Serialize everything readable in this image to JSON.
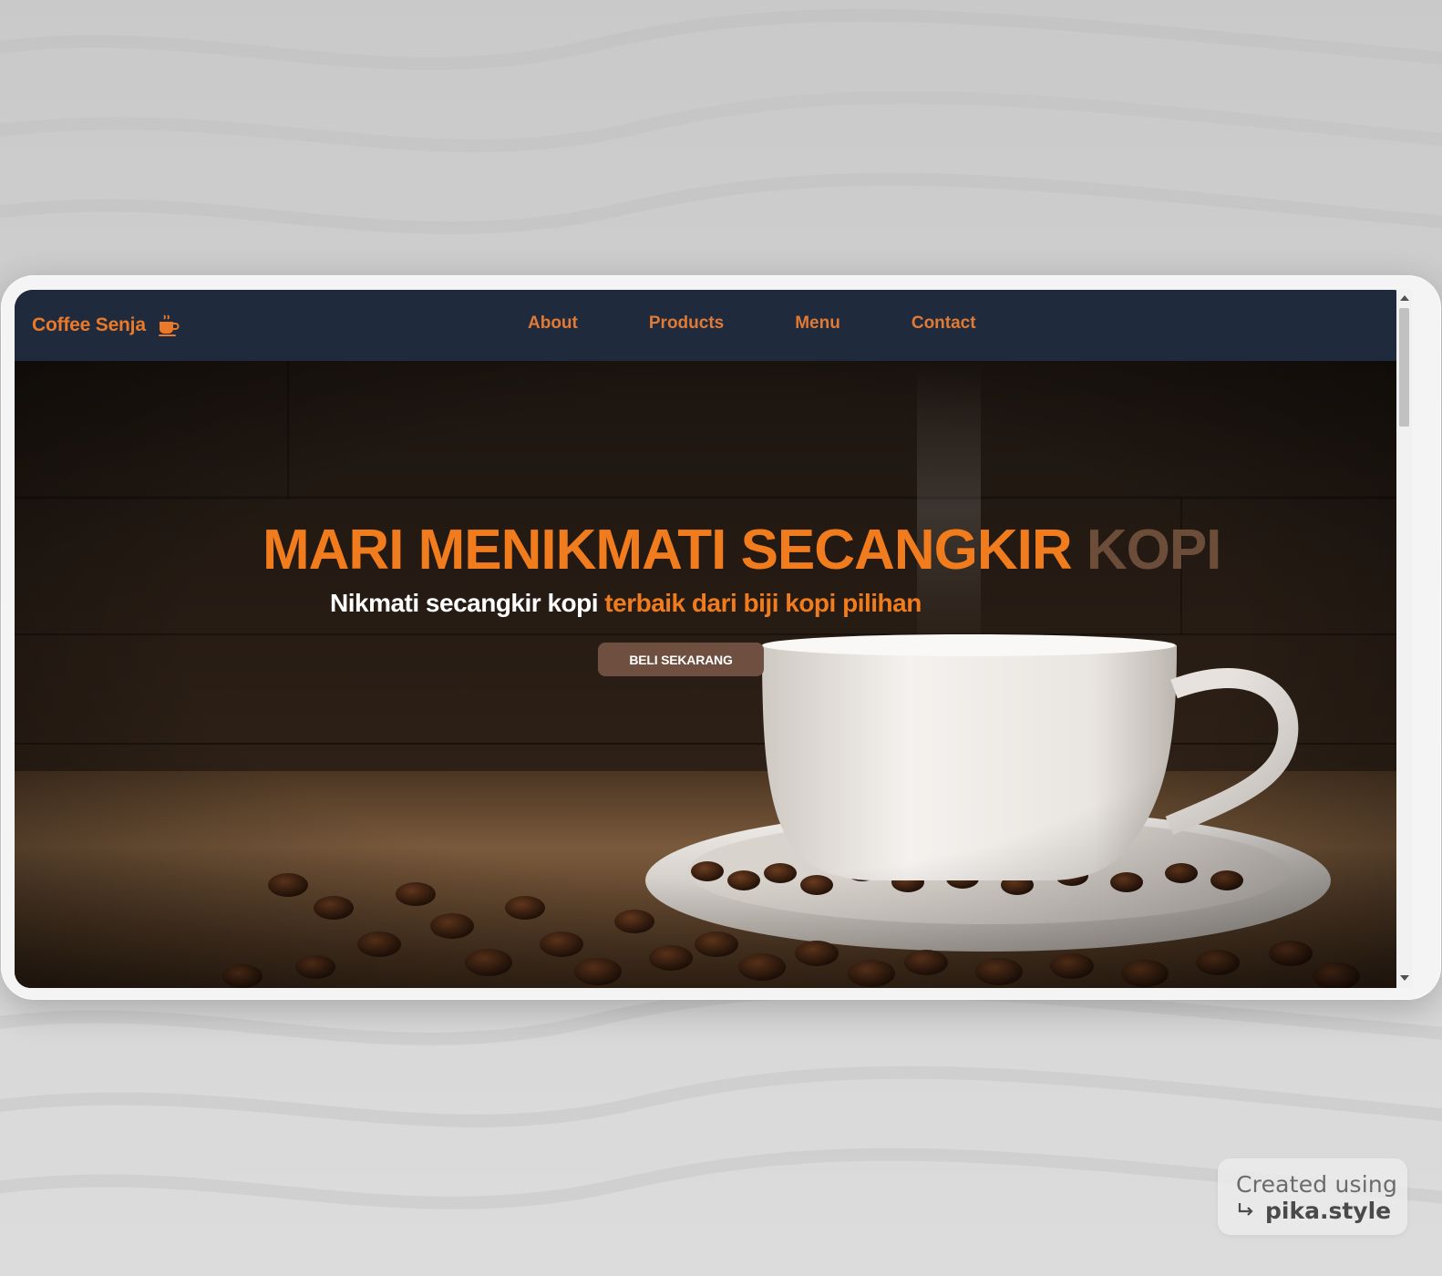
{
  "navbar": {
    "brand": "Coffee Senja",
    "brand_icon": "coffee-cup-icon",
    "links": [
      {
        "label": "About"
      },
      {
        "label": "Products"
      },
      {
        "label": "Menu"
      },
      {
        "label": "Contact"
      }
    ]
  },
  "hero": {
    "title_main": "MARI MENIKMATI SECANGKIR",
    "title_accent": "KOPI",
    "subtitle_white": "Nikmati secangkir kopi",
    "subtitle_orange": "terbaik dari biji kopi pilihan",
    "cta_label": "BELI SEKARANG"
  },
  "watermark": {
    "line1": "Created using",
    "line2": "pika.style"
  },
  "colors": {
    "navbar_bg": "#1f2a3d",
    "accent_orange": "#f07c1e",
    "accent_brown": "#6b4d39",
    "button_bg": "#6f5040"
  }
}
